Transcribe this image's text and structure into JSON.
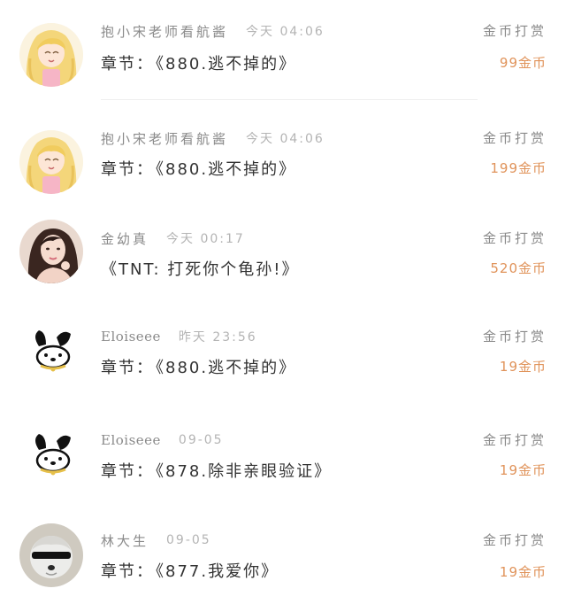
{
  "items": [
    {
      "username": "抱小宋老师看航酱",
      "time": "今天 04:06",
      "content_prefix": "章节：",
      "content": "《880.逃不掉的》",
      "tag": "金币打赏",
      "amount": "99金币",
      "avatar": "anime-girl-avatar"
    },
    {
      "username": "抱小宋老师看航酱",
      "time": "今天 04:06",
      "content_prefix": "章节：",
      "content": "《880.逃不掉的》",
      "tag": "金币打赏",
      "amount": "199金币",
      "avatar": "anime-girl-avatar"
    },
    {
      "username": "金幼真",
      "time": "今天 00:17",
      "content_prefix": "",
      "content": "《TNT: 打死你个龟孙!》",
      "tag": "金币打赏",
      "amount": "520金币",
      "avatar": "woman-photo-avatar"
    },
    {
      "username": "Eloiseee",
      "time": "昨天 23:56",
      "content_prefix": "章节：",
      "content": "《880.逃不掉的》",
      "tag": "金币打赏",
      "amount": "19金币",
      "avatar": "cartoon-dog-avatar"
    },
    {
      "username": "Eloiseee",
      "time": "09-05",
      "content_prefix": "章节：",
      "content": "《878.除非亲眼验证》",
      "tag": "金币打赏",
      "amount": "19金币",
      "avatar": "cartoon-dog-avatar"
    },
    {
      "username": "林大生",
      "time": "09-05",
      "content_prefix": "章节：",
      "content": "《877.我爱你》",
      "tag": "金币打赏",
      "amount": "19金币",
      "avatar": "white-dog-photo-avatar"
    }
  ],
  "colors": {
    "amount": "#e0935a",
    "username": "#8a8a8a",
    "time": "#b4b4b4",
    "content": "#333333"
  }
}
